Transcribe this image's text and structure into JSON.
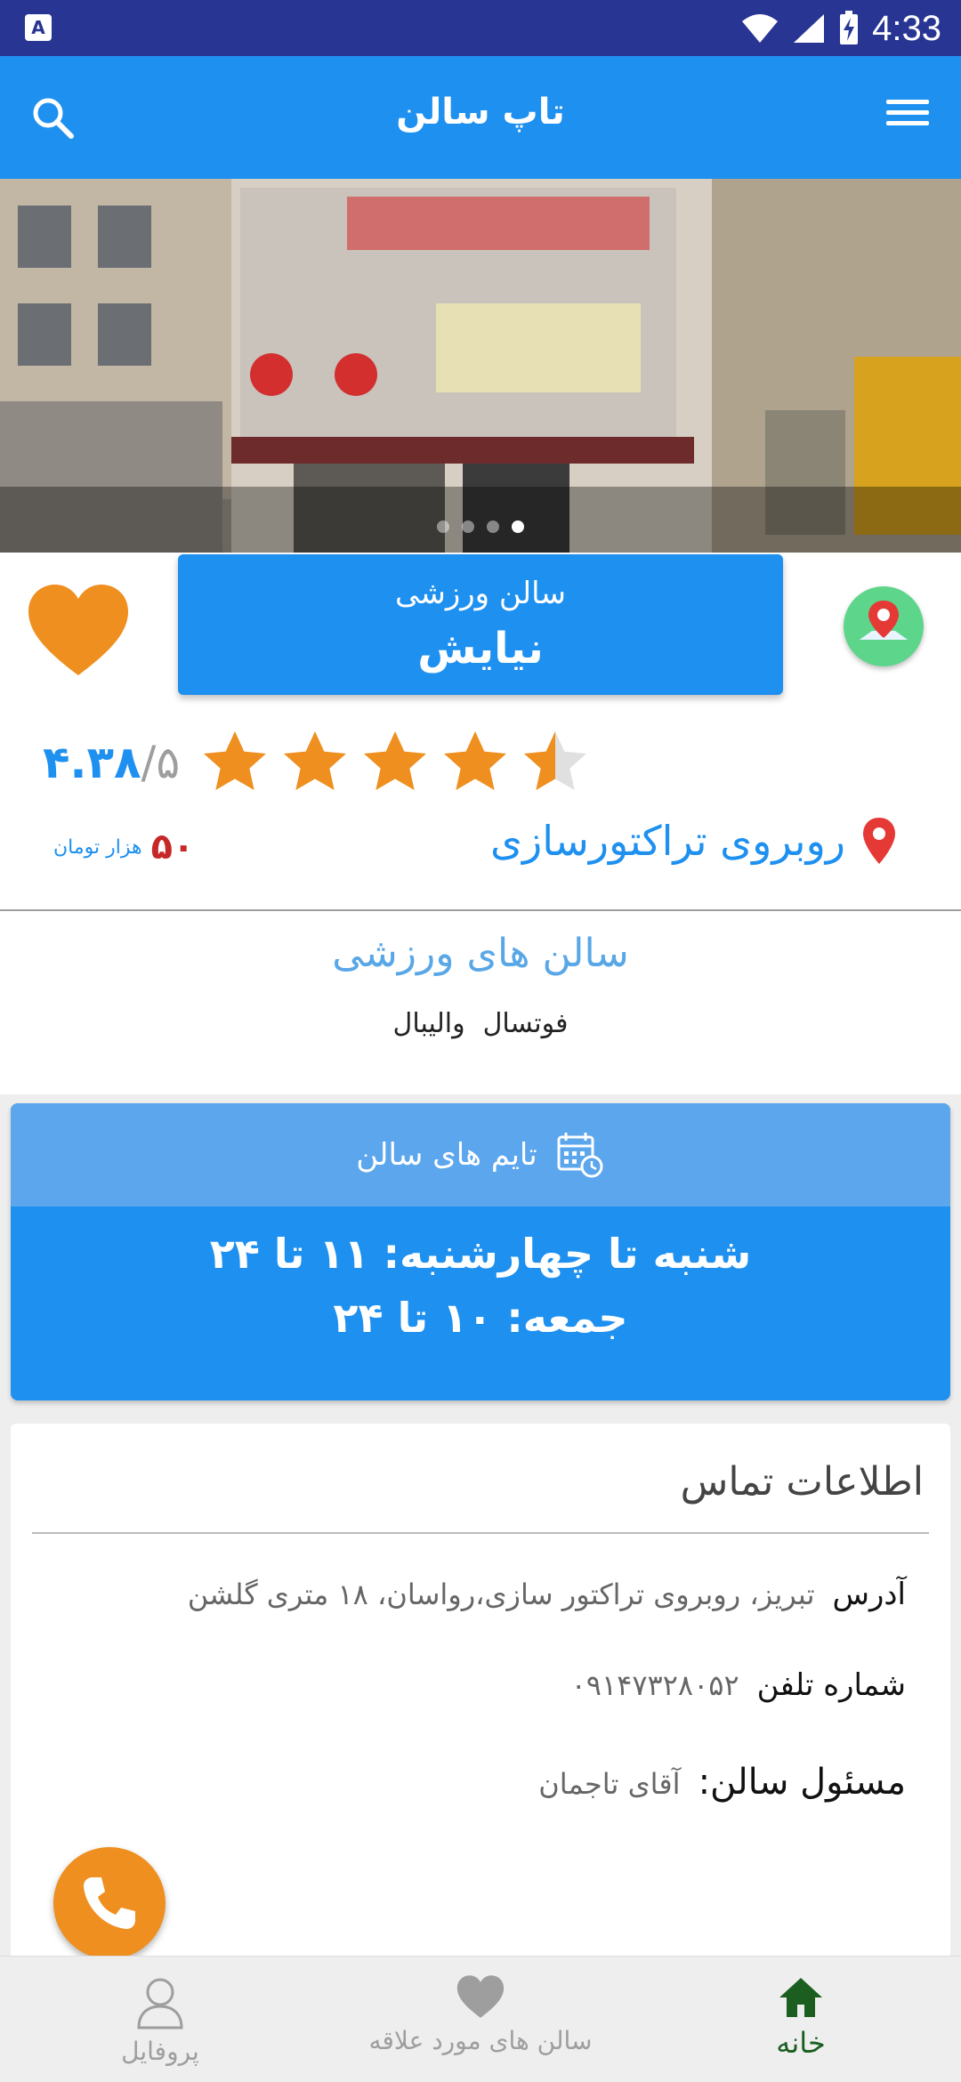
{
  "status_bar": {
    "notification_letter": "A",
    "time": "4:33"
  },
  "app_bar": {
    "title": "تاپ سالن",
    "search_icon": "search-icon",
    "menu_icon": "menu-icon"
  },
  "hero": {
    "slide_count": 4,
    "active_slide": 3
  },
  "venue": {
    "type_label": "سالن ورزشی",
    "name": "نیایش",
    "rating": "۴.۳۸",
    "rating_max": "/۵",
    "stars_value": 4.38,
    "price_value": "۵۰",
    "price_unit": "هزار تومان",
    "location": "روبروی تراکتورسازی",
    "accent_color": "#1e90f0",
    "favorite_color": "#ef8f1f"
  },
  "sports": {
    "title": "سالن های ورزشی",
    "items": [
      "فوتسال",
      "والیبال"
    ]
  },
  "hours": {
    "title": "تایم های سالن",
    "lines": [
      "شنبه تا چهارشنبه:  ۱۱  تا ۲۴",
      "جمعه:  ۱۰  تا ۲۴"
    ]
  },
  "contact": {
    "title": "اطلاعات تماس",
    "address_label": "آدرس",
    "address_value": "تبریز، روبروی تراکتور سازی،رواسان، ۱۸ متری گلشن",
    "phone_label": "شماره تلفن",
    "phone_value": "۰۹۱۴۷۳۲۸۰۵۲",
    "manager_label": "مسئول سالن:",
    "manager_value": "آقای تاجمان"
  },
  "bottom_nav": {
    "items": [
      {
        "label": "پروفایل",
        "icon": "profile-icon"
      },
      {
        "label": "سالن های مورد علاقه",
        "icon": "heart-icon"
      },
      {
        "label": "خانه",
        "icon": "home-icon"
      }
    ],
    "active_index": 2
  }
}
